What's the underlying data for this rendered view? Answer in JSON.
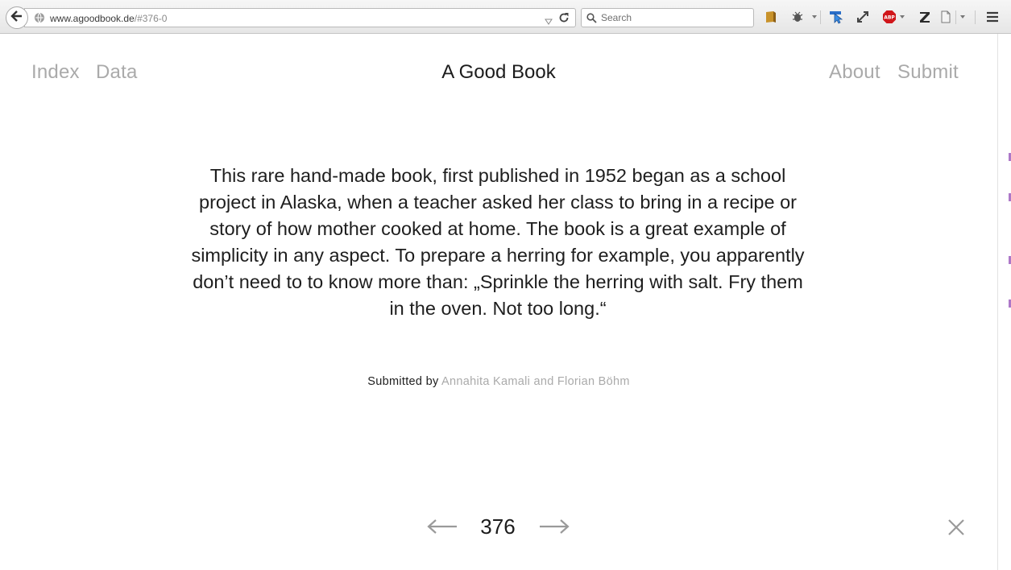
{
  "browser": {
    "url_host": "www.agoodbook.de",
    "url_path": "/#376-0",
    "search_placeholder": "Search"
  },
  "nav": {
    "left": [
      "Index",
      "Data"
    ],
    "title": "A Good Book",
    "right": [
      "About",
      "Submit"
    ]
  },
  "entry": {
    "description": "This rare hand-made book, first published in 1952 began as a school project in Alaska, when a teacher asked her class to bring in a recipe or story of how mother cooked at home. The book is a great example of simplicity in any aspect. To prepare a herring for example, you apparently don’t need to to know more than: „Sprinkle the herring with salt. Fry them in the oven. Not too long.“",
    "submitted_label": "Submitted by",
    "submitters": "Annahita Kamali and Florian Böhm",
    "number": "376"
  },
  "colors": {
    "link_gray": "#aaaaaa",
    "text_dark": "#1e1e1e",
    "adblock_red": "#d0161a"
  }
}
